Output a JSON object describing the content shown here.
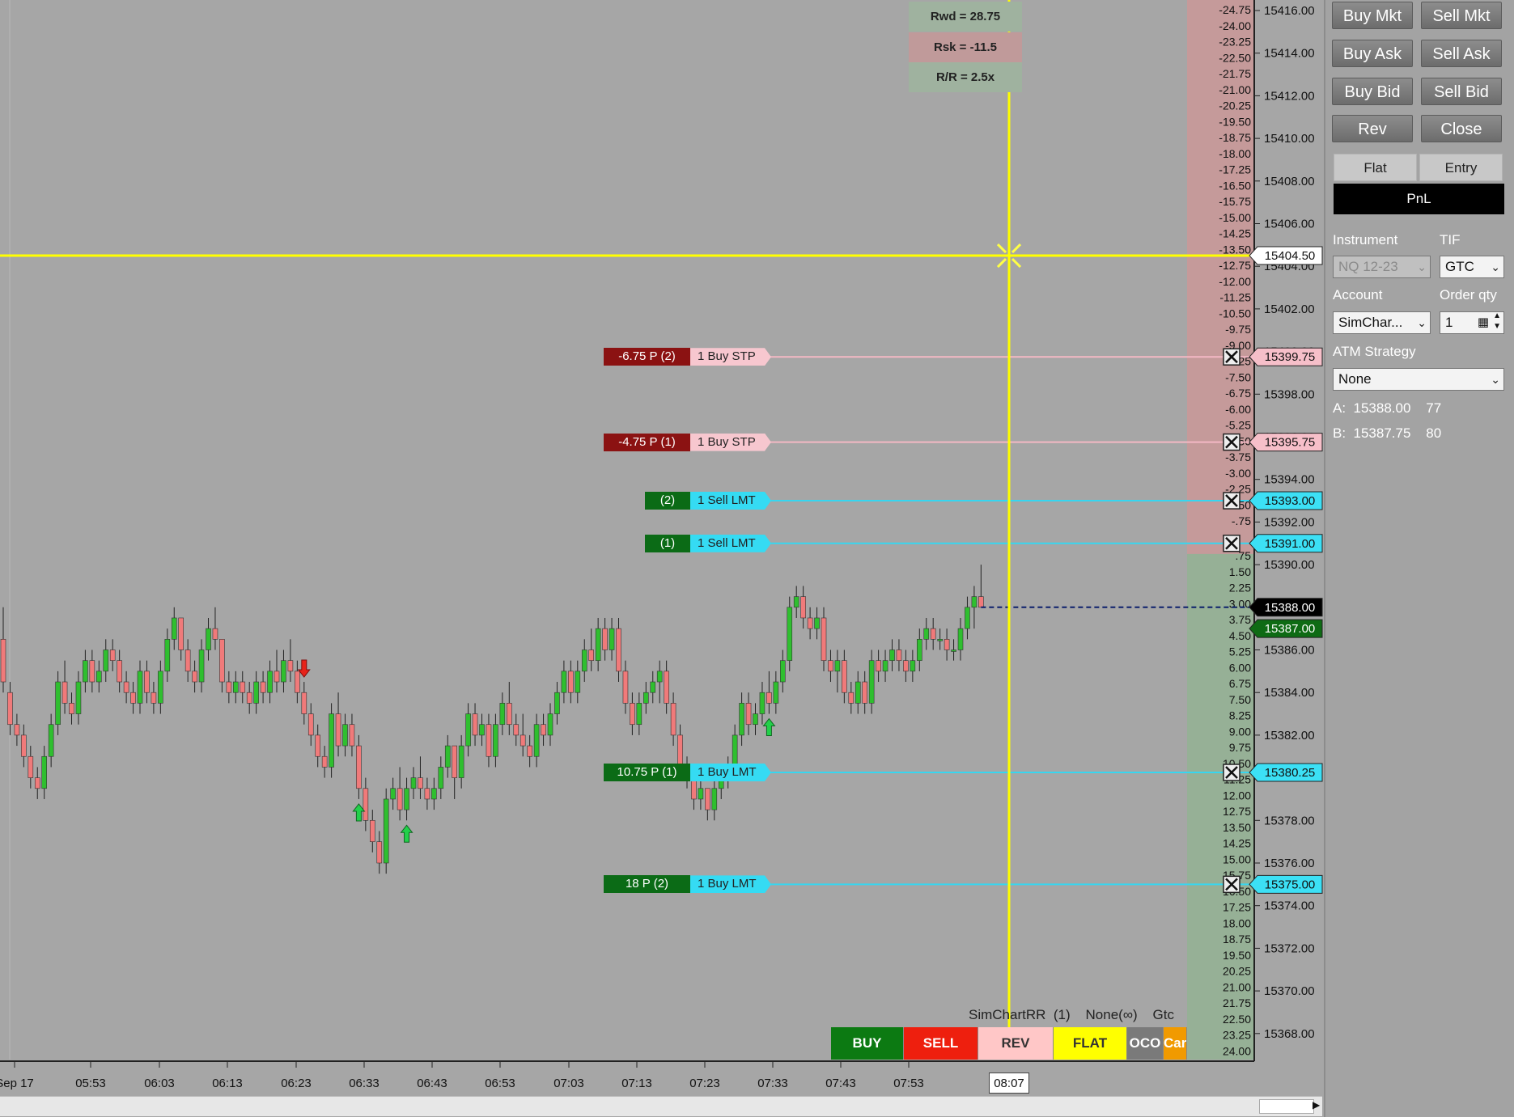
{
  "colors": {
    "background": "#a6a6a6",
    "up_candle": "#2fbf2f",
    "down_candle": "#f07a7a",
    "crosshair": "#ffff00",
    "limit_line": "#36d6f0",
    "stop_line": "#f4b8c4",
    "profit_tag": "#0b6b16",
    "loss_tag": "#8b1212",
    "ask_tag": "#0e6b14",
    "last_tag": "#000000"
  },
  "rr_box": {
    "reward": "Rwd =  28.75",
    "risk": "Rsk =  -11.5",
    "ratio": "R/R =  2.5x"
  },
  "crosshair": {
    "price_label": "15404.50",
    "price": 15404.5,
    "time_label": "08:07"
  },
  "time_axis": [
    "Sep 17",
    "05:53",
    "06:03",
    "06:13",
    "06:23",
    "06:33",
    "06:43",
    "06:53",
    "07:03",
    "07:13",
    "07:23",
    "07:33",
    "07:43",
    "07:53"
  ],
  "price_axis": [
    "15416.00",
    "15414.00",
    "15412.00",
    "15410.00",
    "15408.00",
    "15406.00",
    "15404.00",
    "15402.00",
    "15400.00",
    "15398.00",
    "15396.00",
    "15394.00",
    "15392.00",
    "15390.00",
    "15388.00",
    "15386.00",
    "15384.00",
    "15382.00",
    "15380.00",
    "15378.00",
    "15376.00",
    "15374.00",
    "15372.00",
    "15370.00",
    "15368.00"
  ],
  "pnl_ticks_negative": [
    "-24.75",
    "-24.00",
    "-23.25",
    "-22.50",
    "-21.75",
    "-21.00",
    "-20.25",
    "-19.50",
    "-18.75",
    "-18.00",
    "-17.25",
    "-16.50",
    "-15.75",
    "-15.00",
    "-14.25",
    "-13.50",
    "-12.75",
    "-12.00",
    "-11.25",
    "-10.50",
    "-9.75",
    "-9.00",
    "-8.25",
    "-7.50",
    "-6.75",
    "-6.00",
    "-5.25",
    "-4.50",
    "-3.75",
    "-3.00",
    "-2.25",
    "-1.50",
    "-.75"
  ],
  "pnl_ticks_positive": [
    ".75",
    "1.50",
    "2.25",
    "3.00",
    "3.75",
    "4.50",
    "5.25",
    "6.00",
    "6.75",
    "7.50",
    "8.25",
    "9.00",
    "9.75",
    "10.50",
    "11.25",
    "12.00",
    "12.75",
    "13.50",
    "14.25",
    "15.00",
    "15.75",
    "16.50",
    "17.25",
    "18.00",
    "18.75",
    "19.50",
    "20.25",
    "21.00",
    "21.75",
    "22.50",
    "23.25",
    "24.00"
  ],
  "price_markers": [
    {
      "label": "15399.75",
      "price": 15399.75,
      "kind": "stop"
    },
    {
      "label": "15395.75",
      "price": 15395.75,
      "kind": "stop"
    },
    {
      "label": "15393.00",
      "price": 15393.0,
      "kind": "limit"
    },
    {
      "label": "15391.00",
      "price": 15391.0,
      "kind": "limit"
    },
    {
      "label": "15388.00",
      "price": 15388.0,
      "kind": "last"
    },
    {
      "label": "15387.00",
      "price": 15387.0,
      "kind": "ask"
    },
    {
      "label": "15380.25",
      "price": 15380.25,
      "kind": "limit"
    },
    {
      "label": "15375.00",
      "price": 15375.0,
      "kind": "limit"
    }
  ],
  "orders": [
    {
      "pnl": "-6.75  P (2)",
      "desc": "1  Buy STP",
      "price": 15399.75,
      "kind": "stop"
    },
    {
      "pnl": "-4.75  P (1)",
      "desc": "1  Buy STP",
      "price": 15395.75,
      "kind": "stop"
    },
    {
      "pnl": "(2)",
      "desc": "1  Sell LMT",
      "price": 15393.0,
      "kind": "target"
    },
    {
      "pnl": "(1)",
      "desc": "1  Sell LMT",
      "price": 15391.0,
      "kind": "target"
    },
    {
      "pnl": "10.75  P (1)",
      "desc": "1  Buy LMT",
      "price": 15380.25,
      "kind": "entry"
    },
    {
      "pnl": "18  P (2)",
      "desc": "1  Buy LMT",
      "price": 15375.0,
      "kind": "entry"
    }
  ],
  "bottom_bar": {
    "status": "SimChartRR  (1)    None(∞)    Gtc",
    "buy": "BUY",
    "sell": "SELL",
    "rev": "REV",
    "flat": "FLAT",
    "oco": "OCO",
    "cancel": "Car"
  },
  "panel": {
    "buttons": [
      "Buy Mkt",
      "Sell Mkt",
      "Buy Ask",
      "Sell Ask",
      "Buy Bid",
      "Sell Bid",
      "Rev",
      "Close"
    ],
    "flat_label": "Flat",
    "entry_label": "Entry",
    "pnl_label": "PnL",
    "instrument_label": "Instrument",
    "tif_label": "TIF",
    "instrument_value": "NQ 12-23",
    "tif_value": "GTC",
    "account_label": "Account",
    "order_qty_label": "Order qty",
    "account_value": "SimChar...",
    "order_qty_value": "1",
    "atm_label": "ATM Strategy",
    "atm_value": "None",
    "ask_line": "A:  15388.00    77",
    "bid_line": "B:  15387.75    80"
  },
  "candles": [
    [
      15386.5,
      15388.0,
      15384.0,
      15384.5
    ],
    [
      15384.0,
      15384.5,
      15382.0,
      15382.5
    ],
    [
      15382.5,
      15383.0,
      15381.5,
      15382.0
    ],
    [
      15382.0,
      15382.5,
      15380.5,
      15381.0
    ],
    [
      15381.0,
      15381.5,
      15379.5,
      15380.0
    ],
    [
      15380.0,
      15380.5,
      15379.0,
      15379.5
    ],
    [
      15379.5,
      15381.5,
      15379.0,
      15381.0
    ],
    [
      15381.0,
      15383.0,
      15380.5,
      15382.5
    ],
    [
      15382.5,
      15385.0,
      15382.0,
      15384.5
    ],
    [
      15384.5,
      15385.5,
      15383.0,
      15383.5
    ],
    [
      15383.5,
      15384.0,
      15382.5,
      15383.0
    ],
    [
      15383.0,
      15385.0,
      15382.5,
      15384.5
    ],
    [
      15384.5,
      15386.0,
      15384.0,
      15385.5
    ],
    [
      15385.5,
      15386.0,
      15384.0,
      15384.5
    ],
    [
      15384.5,
      15385.5,
      15384.0,
      15385.0
    ],
    [
      15385.0,
      15386.5,
      15384.5,
      15386.0
    ],
    [
      15386.0,
      15386.5,
      15385.0,
      15385.5
    ],
    [
      15385.5,
      15386.0,
      15384.0,
      15384.5
    ],
    [
      15384.5,
      15385.0,
      15383.5,
      15384.0
    ],
    [
      15384.0,
      15384.5,
      15383.0,
      15383.5
    ],
    [
      15383.5,
      15385.5,
      15383.0,
      15385.0
    ],
    [
      15385.0,
      15385.5,
      15383.5,
      15384.0
    ],
    [
      15384.0,
      15384.5,
      15383.0,
      15383.5
    ],
    [
      15383.5,
      15385.5,
      15383.0,
      15385.0
    ],
    [
      15385.0,
      15387.0,
      15384.5,
      15386.5
    ],
    [
      15386.5,
      15388.0,
      15386.0,
      15387.5
    ],
    [
      15387.5,
      15387.5,
      15385.5,
      15386.0
    ],
    [
      15386.0,
      15386.5,
      15384.5,
      15385.0
    ],
    [
      15385.0,
      15385.5,
      15384.0,
      15384.5
    ],
    [
      15384.5,
      15386.5,
      15384.0,
      15386.0
    ],
    [
      15386.0,
      15387.5,
      15385.5,
      15387.0
    ],
    [
      15387.0,
      15388.0,
      15386.0,
      15386.5
    ],
    [
      15386.5,
      15386.5,
      15384.0,
      15384.5
    ],
    [
      15384.5,
      15385.0,
      15383.5,
      15384.0
    ],
    [
      15384.0,
      15385.0,
      15383.5,
      15384.5
    ],
    [
      15384.5,
      15385.0,
      15383.5,
      15384.0
    ],
    [
      15384.0,
      15384.5,
      15383.0,
      15383.5
    ],
    [
      15383.5,
      15385.0,
      15383.0,
      15384.5
    ],
    [
      15384.5,
      15385.0,
      15383.5,
      15384.0
    ],
    [
      15384.0,
      15385.5,
      15383.5,
      15385.0
    ],
    [
      15385.0,
      15386.0,
      15384.0,
      15384.5
    ],
    [
      15384.5,
      15386.0,
      15384.0,
      15385.5
    ],
    [
      15385.5,
      15386.5,
      15384.5,
      15385.0
    ],
    [
      15385.0,
      15385.5,
      15383.5,
      15384.0
    ],
    [
      15384.0,
      15384.5,
      15382.5,
      15383.0
    ],
    [
      15383.0,
      15383.5,
      15381.5,
      15382.0
    ],
    [
      15382.0,
      15382.5,
      15380.5,
      15381.0
    ],
    [
      15381.0,
      15381.5,
      15380.0,
      15380.5
    ],
    [
      15380.5,
      15383.5,
      15380.0,
      15383.0
    ],
    [
      15383.0,
      15384.0,
      15381.0,
      15381.5
    ],
    [
      15381.5,
      15383.0,
      15381.0,
      15382.5
    ],
    [
      15382.5,
      15383.0,
      15381.0,
      15381.5
    ],
    [
      15381.5,
      15382.0,
      15379.0,
      15379.5
    ],
    [
      15379.5,
      15380.0,
      15377.5,
      15378.0
    ],
    [
      15378.0,
      15378.5,
      15376.5,
      15377.0
    ],
    [
      15377.0,
      15377.5,
      15375.5,
      15376.0
    ],
    [
      15376.0,
      15379.5,
      15375.5,
      15379.0
    ],
    [
      15379.0,
      15380.0,
      15378.5,
      15379.5
    ],
    [
      15379.5,
      15380.5,
      15378.0,
      15378.5
    ],
    [
      15378.5,
      15380.0,
      15378.0,
      15379.5
    ],
    [
      15379.5,
      15380.5,
      15379.0,
      15380.0
    ],
    [
      15380.0,
      15381.0,
      15379.0,
      15379.5
    ],
    [
      15379.5,
      15380.0,
      15378.5,
      15379.0
    ],
    [
      15379.0,
      15380.0,
      15378.5,
      15379.5
    ],
    [
      15379.5,
      15381.0,
      15379.0,
      15380.5
    ],
    [
      15380.5,
      15382.0,
      15380.0,
      15381.5
    ],
    [
      15381.5,
      15381.5,
      15379.0,
      15380.0
    ],
    [
      15380.0,
      15382.0,
      15379.5,
      15381.5
    ],
    [
      15381.5,
      15383.5,
      15381.0,
      15383.0
    ],
    [
      15383.0,
      15383.5,
      15381.5,
      15382.0
    ],
    [
      15382.0,
      15383.0,
      15381.5,
      15382.5
    ],
    [
      15382.5,
      15383.0,
      15380.5,
      15381.0
    ],
    [
      15381.0,
      15383.0,
      15380.5,
      15382.5
    ],
    [
      15382.5,
      15384.0,
      15382.0,
      15383.5
    ],
    [
      15383.5,
      15384.5,
      15382.0,
      15382.5
    ],
    [
      15382.5,
      15383.0,
      15381.5,
      15382.0
    ],
    [
      15382.0,
      15383.0,
      15381.0,
      15381.5
    ],
    [
      15381.5,
      15382.0,
      15380.5,
      15381.0
    ],
    [
      15381.0,
      15383.0,
      15380.5,
      15382.5
    ],
    [
      15382.5,
      15383.0,
      15381.5,
      15382.0
    ],
    [
      15382.0,
      15383.5,
      15381.5,
      15383.0
    ],
    [
      15383.0,
      15384.5,
      15382.5,
      15384.0
    ],
    [
      15384.0,
      15385.5,
      15383.5,
      15385.0
    ],
    [
      15385.0,
      15385.5,
      15383.5,
      15384.0
    ],
    [
      15384.0,
      15385.5,
      15383.5,
      15385.0
    ],
    [
      15385.0,
      15386.5,
      15384.5,
      15386.0
    ],
    [
      15386.0,
      15387.0,
      15385.0,
      15385.5
    ],
    [
      15385.5,
      15387.5,
      15385.0,
      15387.0
    ],
    [
      15387.0,
      15387.5,
      15385.5,
      15386.0
    ],
    [
      15386.0,
      15387.5,
      15385.5,
      15387.0
    ],
    [
      15387.0,
      15387.5,
      15384.5,
      15385.0
    ],
    [
      15385.0,
      15385.5,
      15383.0,
      15383.5
    ],
    [
      15383.5,
      15384.0,
      15382.0,
      15382.5
    ],
    [
      15382.5,
      15384.0,
      15382.0,
      15383.5
    ],
    [
      15383.5,
      15384.5,
      15383.0,
      15384.0
    ],
    [
      15384.0,
      15385.0,
      15383.5,
      15384.5
    ],
    [
      15384.5,
      15385.5,
      15383.5,
      15385.0
    ],
    [
      15385.0,
      15385.5,
      15383.0,
      15383.5
    ],
    [
      15383.5,
      15384.0,
      15381.5,
      15382.0
    ],
    [
      15382.0,
      15382.5,
      15380.0,
      15380.5
    ],
    [
      15380.5,
      15381.0,
      15379.5,
      15380.0
    ],
    [
      15380.0,
      15380.5,
      15378.5,
      15379.0
    ],
    [
      15379.0,
      15380.0,
      15378.5,
      15379.5
    ],
    [
      15379.5,
      15379.5,
      15378.0,
      15378.5
    ],
    [
      15378.5,
      15380.0,
      15378.0,
      15379.5
    ],
    [
      15379.5,
      15380.5,
      15379.0,
      15380.0
    ],
    [
      15380.0,
      15381.0,
      15379.5,
      15380.5
    ],
    [
      15380.5,
      15382.5,
      15380.0,
      15382.0
    ],
    [
      15382.0,
      15384.0,
      15381.5,
      15383.5
    ],
    [
      15383.5,
      15384.0,
      15382.0,
      15382.5
    ],
    [
      15382.5,
      15383.5,
      15382.0,
      15383.0
    ],
    [
      15383.0,
      15384.5,
      15382.5,
      15384.0
    ],
    [
      15384.0,
      15385.0,
      15383.0,
      15383.5
    ],
    [
      15383.5,
      15385.0,
      15383.0,
      15384.5
    ],
    [
      15384.5,
      15386.0,
      15384.0,
      15385.5
    ],
    [
      15385.5,
      15388.5,
      15385.0,
      15388.0
    ],
    [
      15388.0,
      15389.0,
      15387.5,
      15388.5
    ],
    [
      15388.5,
      15389.0,
      15387.0,
      15387.5
    ],
    [
      15387.5,
      15388.0,
      15386.5,
      15387.0
    ],
    [
      15387.0,
      15388.0,
      15386.5,
      15387.5
    ],
    [
      15387.5,
      15388.0,
      15385.0,
      15385.5
    ],
    [
      15385.5,
      15386.0,
      15384.5,
      15385.0
    ],
    [
      15385.0,
      15386.0,
      15384.0,
      15385.5
    ],
    [
      15385.5,
      15386.0,
      15383.5,
      15384.0
    ],
    [
      15384.0,
      15384.5,
      15383.0,
      15383.5
    ],
    [
      15383.5,
      15385.0,
      15383.0,
      15384.5
    ],
    [
      15384.5,
      15385.0,
      15383.0,
      15383.5
    ],
    [
      15383.5,
      15386.0,
      15383.0,
      15385.5
    ],
    [
      15385.5,
      15386.0,
      15384.5,
      15385.0
    ],
    [
      15385.0,
      15386.0,
      15384.5,
      15385.5
    ],
    [
      15385.5,
      15386.5,
      15385.0,
      15386.0
    ],
    [
      15386.0,
      15386.5,
      15385.0,
      15385.5
    ],
    [
      15385.5,
      15386.0,
      15384.5,
      15385.0
    ],
    [
      15385.0,
      15386.0,
      15384.5,
      15385.5
    ],
    [
      15385.5,
      15387.0,
      15385.0,
      15386.5
    ],
    [
      15386.5,
      15387.5,
      15386.0,
      15387.0
    ],
    [
      15387.0,
      15387.5,
      15386.0,
      15386.5
    ],
    [
      15386.5,
      15387.0,
      15386.0,
      15386.5
    ],
    [
      15386.5,
      15387.0,
      15385.5,
      15386.0
    ],
    [
      15386.0,
      15386.5,
      15385.5,
      15386.0
    ],
    [
      15386.0,
      15387.5,
      15385.5,
      15387.0
    ],
    [
      15387.0,
      15388.5,
      15386.5,
      15388.0
    ],
    [
      15388.0,
      15389.0,
      15387.0,
      15388.5
    ],
    [
      15388.5,
      15390.0,
      15388.0,
      15388.0
    ]
  ],
  "signal_arrows": [
    {
      "bar": 52,
      "dir": "up"
    },
    {
      "bar": 44,
      "dir": "down"
    },
    {
      "bar": 59,
      "dir": "up"
    },
    {
      "bar": 112,
      "dir": "up"
    }
  ]
}
